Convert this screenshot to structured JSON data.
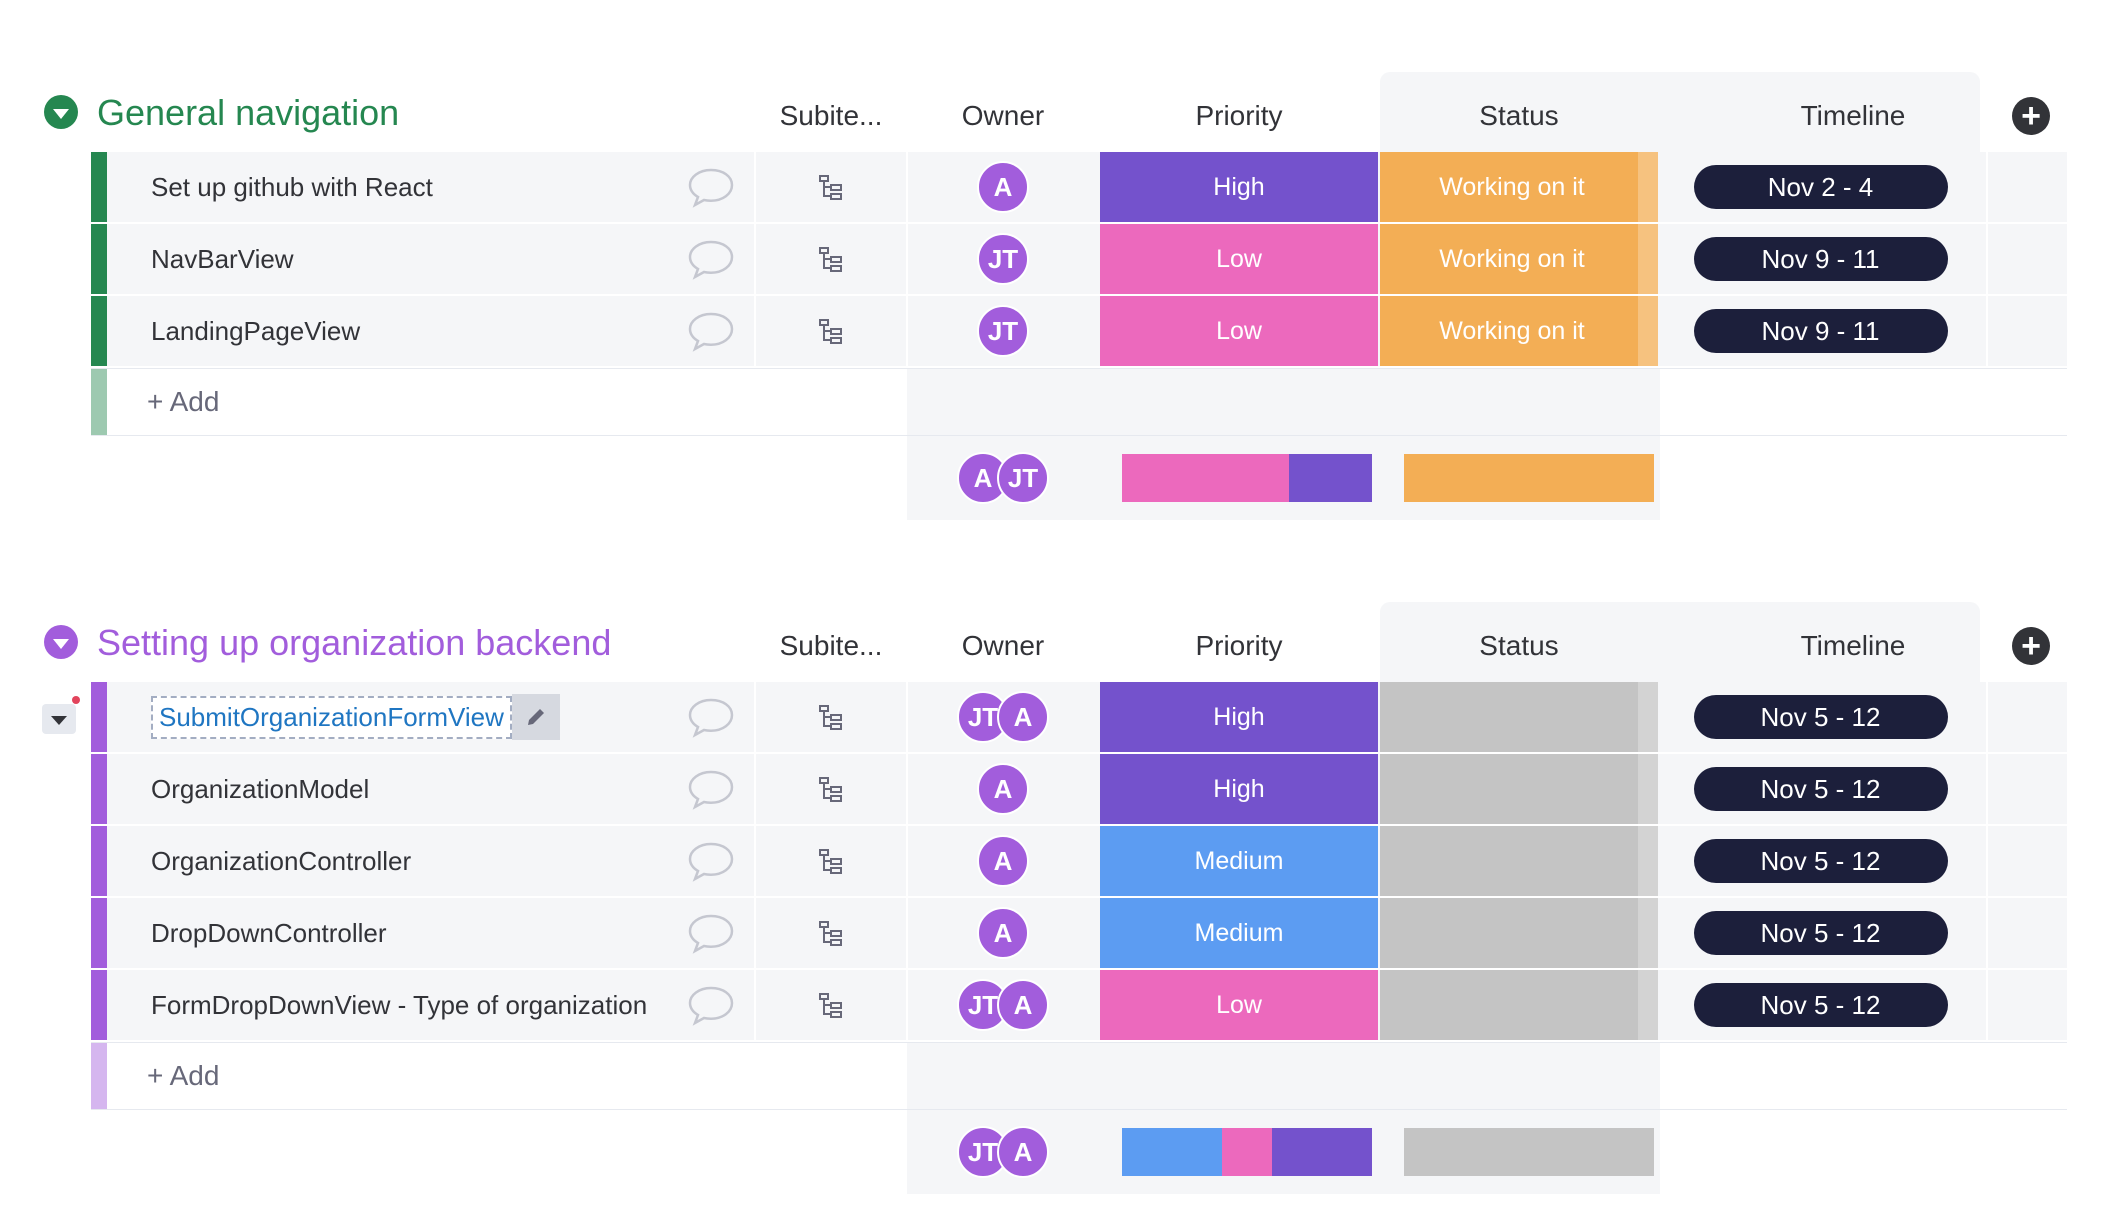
{
  "columns": {
    "subitems": "Subite...",
    "owner": "Owner",
    "priority": "Priority",
    "status": "Status",
    "timeline": "Timeline"
  },
  "colors": {
    "group1": "#258750",
    "group2": "#a25ddc",
    "high": "#7452cc",
    "low": "#ec69bd",
    "medium": "#5c9cf2",
    "working": "#f3ae55",
    "empty_status": "#c4c4c4",
    "timeline": "#1c1f3b",
    "avatar": "#a25ddc"
  },
  "add_label": "+ Add",
  "groups": [
    {
      "title": "General navigation",
      "items": [
        {
          "name": "Set up github with React",
          "owners": [
            "A"
          ],
          "priority": "High",
          "status": "Working on it",
          "timeline": "Nov 2 - 4"
        },
        {
          "name": "NavBarView",
          "owners": [
            "JT"
          ],
          "priority": "Low",
          "status": "Working on it",
          "timeline": "Nov 9 - 11"
        },
        {
          "name": "LandingPageView",
          "owners": [
            "JT"
          ],
          "priority": "Low",
          "status": "Working on it",
          "timeline": "Nov 9 - 11"
        }
      ],
      "summary_owners": [
        "A",
        "JT"
      ],
      "priority_summary": [
        {
          "label": "Low",
          "share": 0.667
        },
        {
          "label": "High",
          "share": 0.333
        }
      ],
      "status_summary": [
        {
          "label": "Working on it",
          "share": 1.0
        }
      ]
    },
    {
      "title": "Setting up organization backend",
      "items": [
        {
          "name": "SubmitOrganizationFormView",
          "owners": [
            "JT",
            "A"
          ],
          "priority": "High",
          "status": "",
          "timeline": "Nov 5 - 12"
        },
        {
          "name": "OrganizationModel",
          "owners": [
            "A"
          ],
          "priority": "High",
          "status": "",
          "timeline": "Nov 5 - 12"
        },
        {
          "name": "OrganizationController",
          "owners": [
            "A"
          ],
          "priority": "Medium",
          "status": "",
          "timeline": "Nov 5 - 12"
        },
        {
          "name": "DropDownController",
          "owners": [
            "A"
          ],
          "priority": "Medium",
          "status": "",
          "timeline": "Nov 5 - 12"
        },
        {
          "name": "FormDropDownView - Type of organization",
          "owners": [
            "JT",
            "A"
          ],
          "priority": "Low",
          "status": "",
          "timeline": "Nov 5 - 12"
        }
      ],
      "summary_owners": [
        "JT",
        "A"
      ],
      "priority_summary": [
        {
          "label": "Medium",
          "share": 0.4
        },
        {
          "label": "Low",
          "share": 0.2
        },
        {
          "label": "High",
          "share": 0.4
        }
      ],
      "status_summary": [
        {
          "label": "",
          "share": 1.0
        }
      ]
    }
  ]
}
